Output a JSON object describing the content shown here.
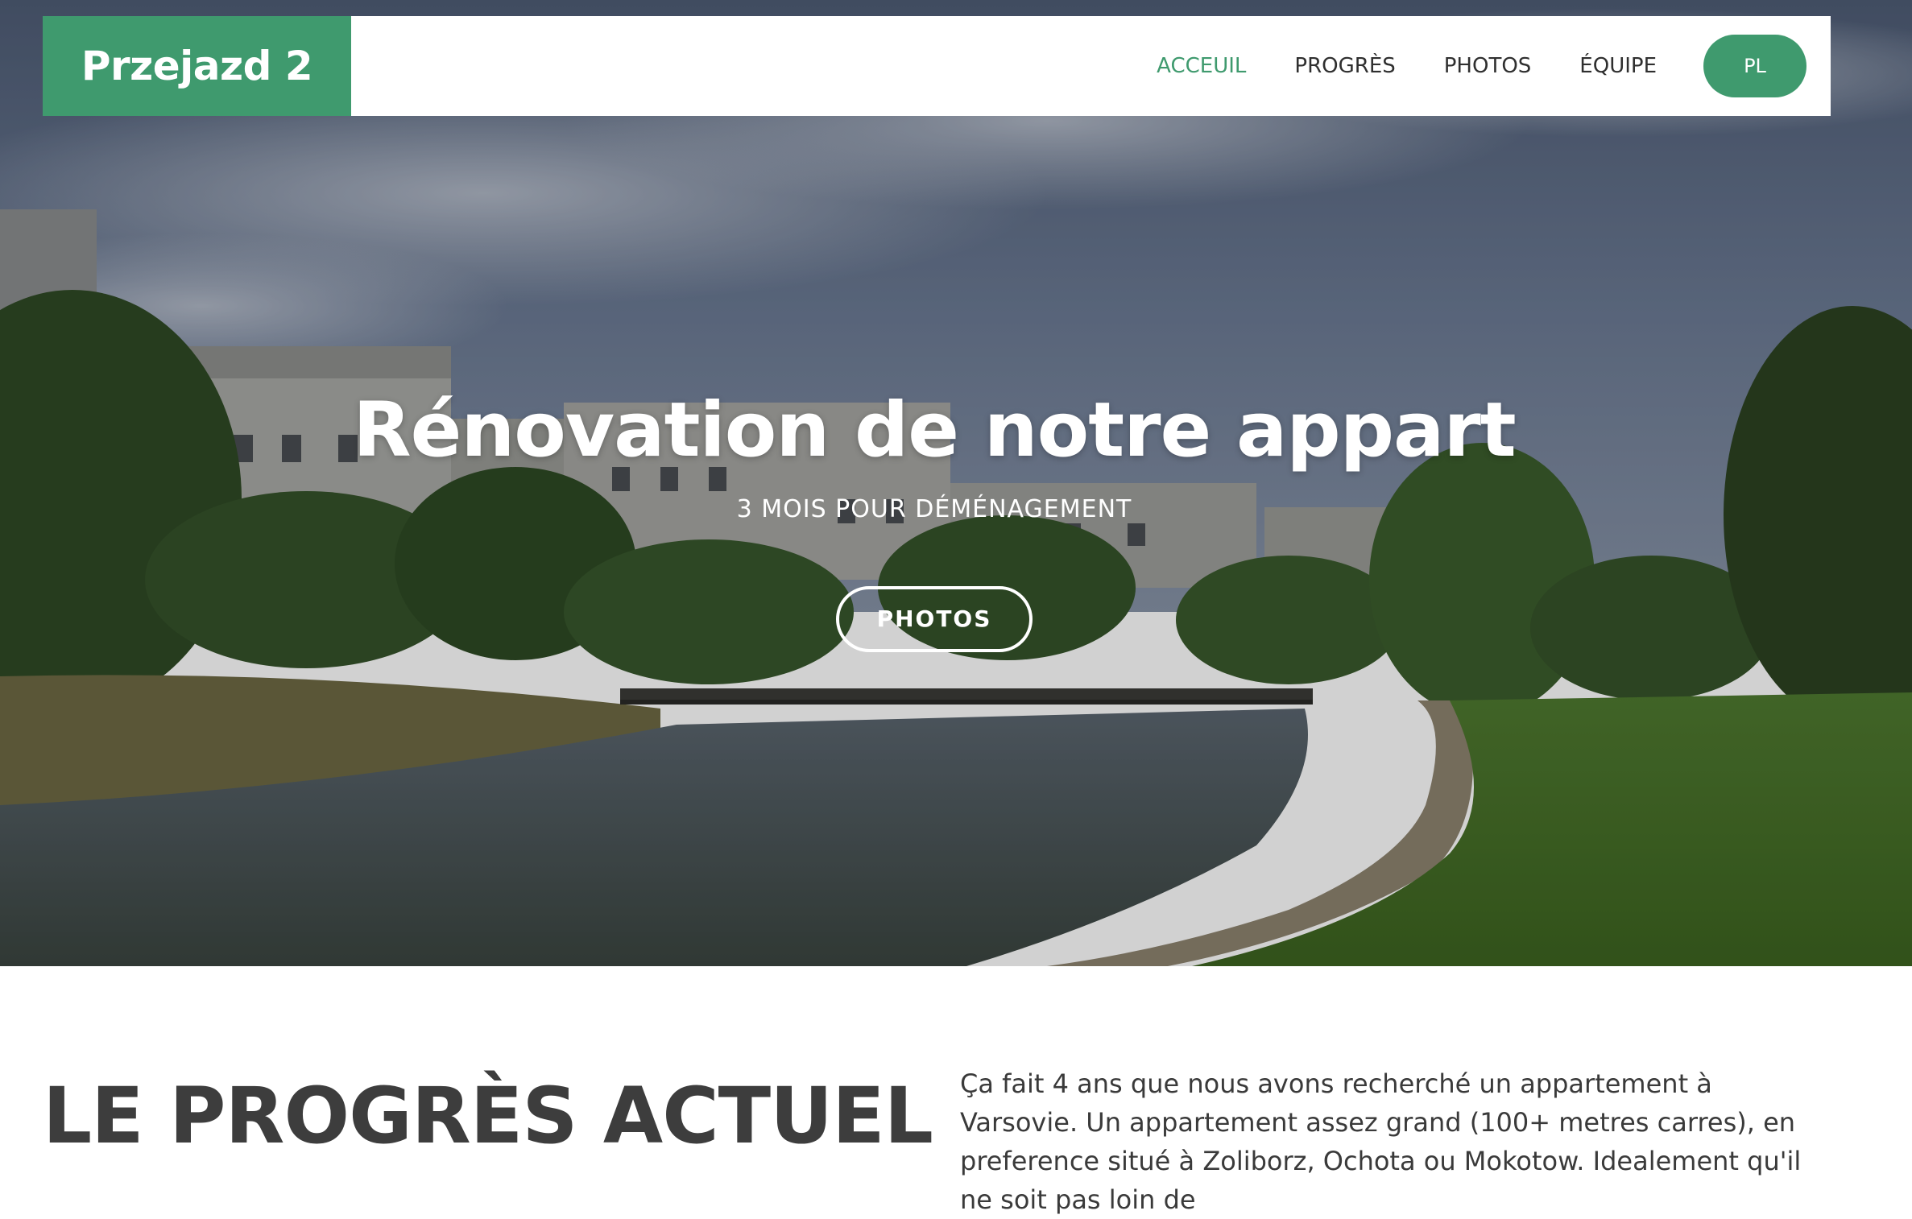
{
  "nav": {
    "brand": "Przejazd 2",
    "links": [
      {
        "label": "ACCEUIL",
        "active": true
      },
      {
        "label": "PROGRÈS",
        "active": false
      },
      {
        "label": "PHOTOS",
        "active": false
      },
      {
        "label": "ÉQUIPE",
        "active": false
      }
    ],
    "lang_button": "PL"
  },
  "hero": {
    "title": "Rénovation de notre appart",
    "subtitle": "3 MOIS POUR DÉMÉNAGEMENT",
    "button_label": "PHOTOS",
    "background_description_icon": "park-pond-photo"
  },
  "progress_section": {
    "title": "LE PROGRÈS ACTUEL",
    "text": "Ça fait 4 ans que nous avons recherché un appartement à Varsovie. Un appartement assez grand (100+ metres carres), en preference situé à Zoliborz, Ochota ou Mokotow. Idealement qu'il ne soit pas loin de"
  },
  "colors": {
    "accent": "#3f9a6e",
    "heading": "#3d3d3d",
    "body_text": "#3a3a3a",
    "nav_text": "#2f2f2f"
  }
}
